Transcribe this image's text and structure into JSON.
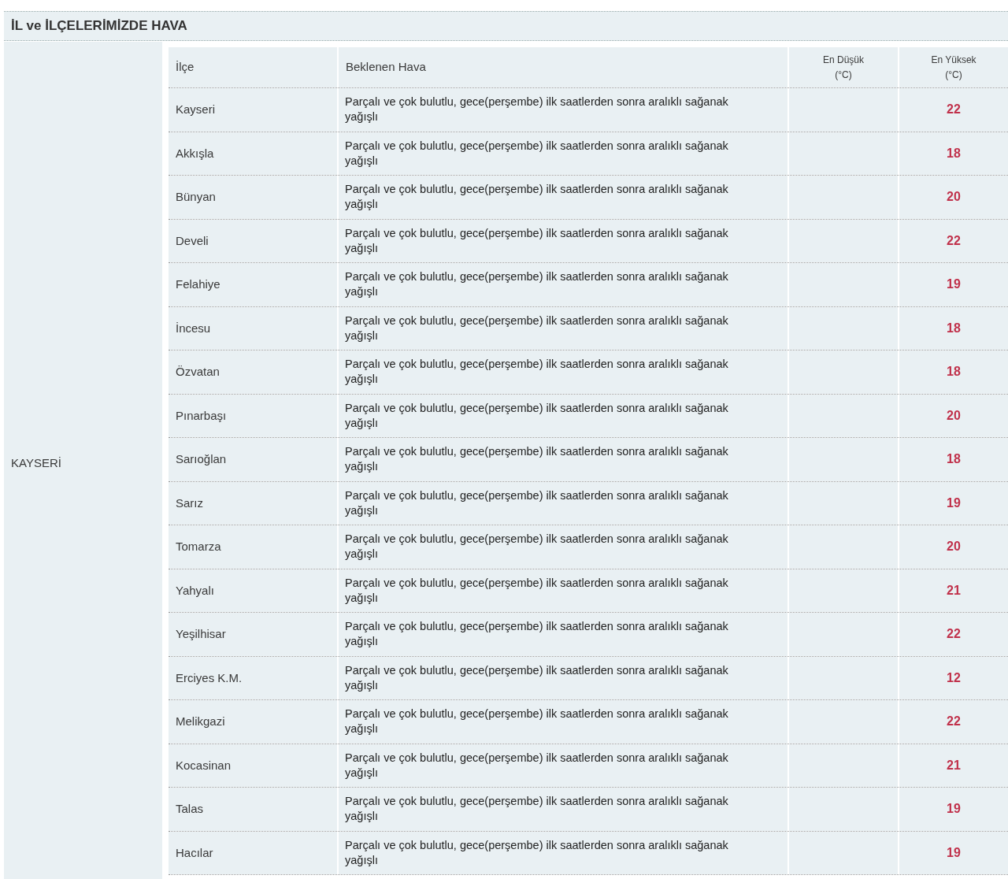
{
  "title": "İL ve İLÇELERİMİZDE HAVA",
  "province": "KAYSERİ",
  "columns": [
    {
      "label": "İlçe"
    },
    {
      "label": "Beklenen Hava"
    },
    {
      "label": "En Düşük",
      "unit": "(°C)"
    },
    {
      "label": "En Yüksek",
      "unit": "(°C)"
    }
  ],
  "rows": [
    {
      "district": "Kayseri",
      "forecast": "Parçalı ve çok bulutlu, gece(perşembe) ilk saatlerden sonra aralıklı sağanak yağışlı",
      "high": "22"
    },
    {
      "district": "Akkışla",
      "forecast": "Parçalı ve çok bulutlu, gece(perşembe) ilk saatlerden sonra aralıklı sağanak yağışlı",
      "high": "18"
    },
    {
      "district": "Bünyan",
      "forecast": "Parçalı ve çok bulutlu, gece(perşembe) ilk saatlerden sonra aralıklı sağanak yağışlı",
      "high": "20"
    },
    {
      "district": "Develi",
      "forecast": "Parçalı ve çok bulutlu, gece(perşembe) ilk saatlerden sonra aralıklı sağanak yağışlı",
      "high": "22"
    },
    {
      "district": "Felahiye",
      "forecast": "Parçalı ve çok bulutlu, gece(perşembe) ilk saatlerden sonra aralıklı sağanak yağışlı",
      "high": "19"
    },
    {
      "district": "İncesu",
      "forecast": "Parçalı ve çok bulutlu, gece(perşembe) ilk saatlerden sonra aralıklı sağanak yağışlı",
      "high": "18"
    },
    {
      "district": "Özvatan",
      "forecast": "Parçalı ve çok bulutlu, gece(perşembe) ilk saatlerden sonra aralıklı sağanak yağışlı",
      "high": "18"
    },
    {
      "district": "Pınarbaşı",
      "forecast": "Parçalı ve çok bulutlu, gece(perşembe) ilk saatlerden sonra aralıklı sağanak yağışlı",
      "high": "20"
    },
    {
      "district": "Sarıoğlan",
      "forecast": "Parçalı ve çok bulutlu, gece(perşembe) ilk saatlerden sonra aralıklı sağanak yağışlı",
      "high": "18"
    },
    {
      "district": "Sarız",
      "forecast": "Parçalı ve çok bulutlu, gece(perşembe) ilk saatlerden sonra aralıklı sağanak yağışlı",
      "high": "19"
    },
    {
      "district": "Tomarza",
      "forecast": "Parçalı ve çok bulutlu, gece(perşembe) ilk saatlerden sonra aralıklı sağanak yağışlı",
      "high": "20"
    },
    {
      "district": "Yahyalı",
      "forecast": "Parçalı ve çok bulutlu, gece(perşembe) ilk saatlerden sonra aralıklı sağanak yağışlı",
      "high": "21"
    },
    {
      "district": "Yeşilhisar",
      "forecast": "Parçalı ve çok bulutlu, gece(perşembe) ilk saatlerden sonra aralıklı sağanak yağışlı",
      "high": "22"
    },
    {
      "district": "Erciyes K.M.",
      "forecast": "Parçalı ve çok bulutlu, gece(perşembe) ilk saatlerden sonra aralıklı sağanak yağışlı",
      "high": "12"
    },
    {
      "district": "Melikgazi",
      "forecast": "Parçalı ve çok bulutlu, gece(perşembe) ilk saatlerden sonra aralıklı sağanak yağışlı",
      "high": "22"
    },
    {
      "district": "Kocasinan",
      "forecast": "Parçalı ve çok bulutlu, gece(perşembe) ilk saatlerden sonra aralıklı sağanak yağışlı",
      "high": "21"
    },
    {
      "district": "Talas",
      "forecast": "Parçalı ve çok bulutlu, gece(perşembe) ilk saatlerden sonra aralıklı sağanak yağışlı",
      "high": "19"
    },
    {
      "district": "Hacılar",
      "forecast": "Parçalı ve çok bulutlu, gece(perşembe) ilk saatlerden sonra aralıklı sağanak yağışlı",
      "high": "19"
    }
  ]
}
